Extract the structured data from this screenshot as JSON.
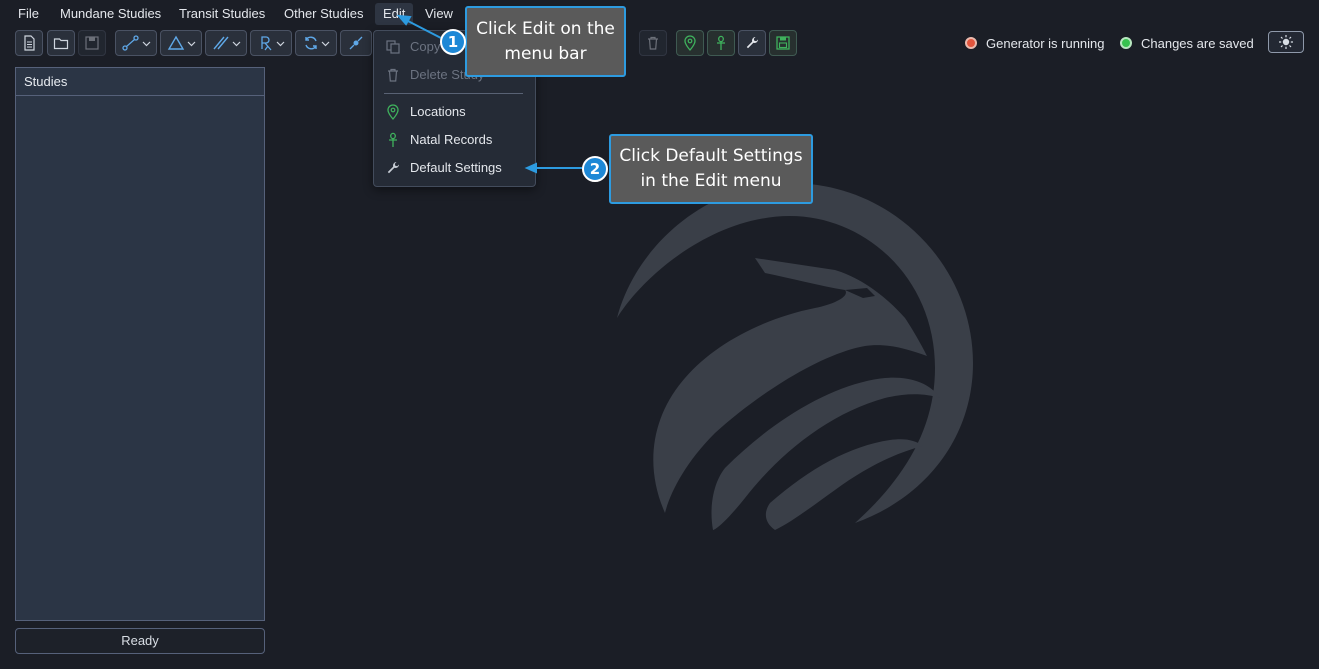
{
  "menubar": {
    "items": [
      "File",
      "Mundane Studies",
      "Transit Studies",
      "Other Studies",
      "Edit",
      "View"
    ],
    "active": "Edit"
  },
  "toolbar": {
    "buttons": [
      {
        "icon": "new-document-icon"
      },
      {
        "icon": "open-folder-icon"
      },
      {
        "icon": "save-disk-icon",
        "disabled": true
      },
      {
        "icon": "aspect-link-icon",
        "dropdown": true
      },
      {
        "icon": "triangle-icon",
        "dropdown": true
      },
      {
        "icon": "parallel-lines-icon",
        "dropdown": true
      },
      {
        "icon": "retrograde-icon",
        "dropdown": true
      },
      {
        "icon": "cycle-icon",
        "dropdown": true
      },
      {
        "icon": "pointer-icon",
        "dropdown": true
      },
      {
        "icon": "trash-icon",
        "disabled": true
      },
      {
        "icon": "location-pin-icon"
      },
      {
        "icon": "ankh-icon"
      },
      {
        "icon": "wrench-icon"
      },
      {
        "icon": "green-save-icon"
      }
    ]
  },
  "status": {
    "generator": "Generator is running",
    "saved": "Changes are saved"
  },
  "theme_toggle": {
    "icon": "sun-icon"
  },
  "studies_panel": {
    "title": "Studies"
  },
  "status_bar": {
    "text": "Ready"
  },
  "edit_menu": {
    "items": [
      {
        "label": "Copy",
        "icon": "copy-icon",
        "disabled": true
      },
      {
        "label": "Delete Study",
        "icon": "trash-icon",
        "disabled": true
      },
      {
        "label": "Locations",
        "icon": "location-pin-icon",
        "disabled": false
      },
      {
        "label": "Natal Records",
        "icon": "ankh-icon",
        "disabled": false
      },
      {
        "label": "Default Settings",
        "icon": "wrench-icon",
        "disabled": false
      }
    ]
  },
  "callouts": [
    {
      "number": "1",
      "text": "Click Edit on the menu bar"
    },
    {
      "number": "2",
      "text": "Click Default Settings in the Edit menu"
    }
  ],
  "colors": {
    "background": "#1b1e26",
    "panel": "#2b3545",
    "accent_green": "#3fb25d",
    "callout_border": "#2d9be0",
    "callout_bg": "#5a5a5a"
  }
}
